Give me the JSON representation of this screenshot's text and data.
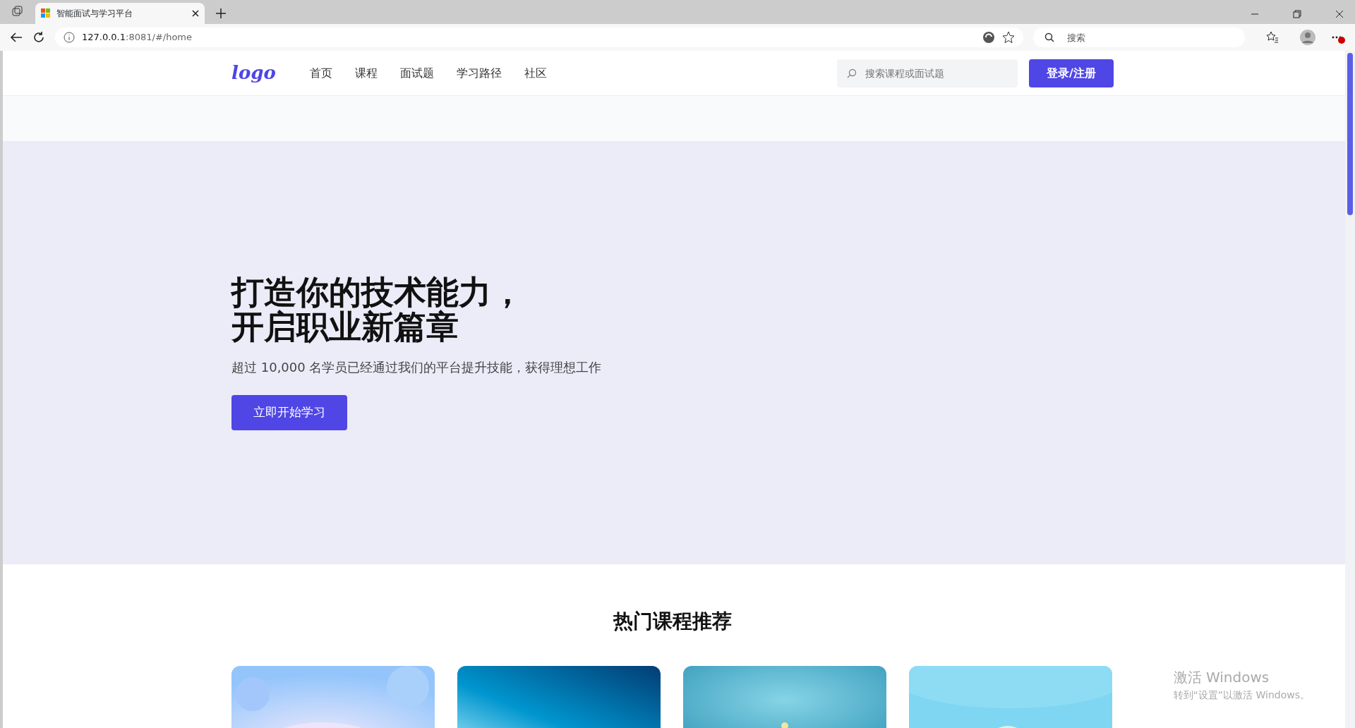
{
  "browser": {
    "tab": {
      "title": "智能面试与学习平台"
    },
    "address": {
      "host": "127.0.0.1",
      "rest": ":8081/#/home"
    },
    "search": {
      "placeholder": "搜索"
    }
  },
  "site_nav": {
    "logo": "logo",
    "links": [
      {
        "label": "首页"
      },
      {
        "label": "课程"
      },
      {
        "label": "面试题"
      },
      {
        "label": "学习路径"
      },
      {
        "label": "社区"
      }
    ],
    "search": {
      "placeholder": "搜索课程或面试题"
    },
    "login": "登录/注册"
  },
  "hero": {
    "title_lines": [
      "打造你的技术能力，",
      "开启职业新篇章"
    ],
    "subtitle": "超过 10,000 名学员已经通过我们的平台提升技能，获得理想工作",
    "cta": "立即开始学习"
  },
  "courses": {
    "title": "热门课程推荐"
  },
  "os_notice": {
    "title": "激活 Windows",
    "text": "转到“设置”以激活 Windows。"
  }
}
